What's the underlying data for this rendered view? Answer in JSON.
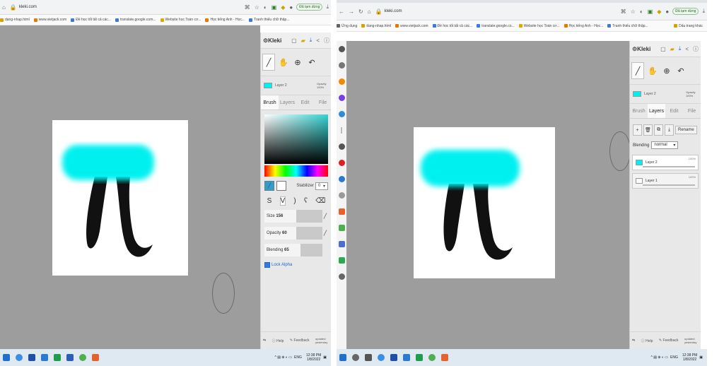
{
  "left": {
    "address": "kleki.com",
    "bookmarks": [
      "dang-nhap.html",
      "www.vietjack.com",
      "Đề học tốt tất cả các...",
      "translate.google.com...",
      "Website học Toán cơ...",
      "Học tiếng Anh - Học...",
      "Tranh thiếu chữ thập..."
    ],
    "profile_label": "Đã tạm dừng",
    "panel": {
      "logo": "Kleki",
      "layer_name": "Layer 2",
      "opacity_label": "Opacity 100%",
      "tabs": [
        "Brush",
        "Layers",
        "Edit",
        "File"
      ],
      "active_tab": "Brush",
      "stabilizer_label": "Stabilizer",
      "stabilizer_value": "0",
      "size_label": "Size",
      "size_value": "156",
      "opacity_slider_label": "Opacity",
      "opacity_slider_value": "60",
      "blending_label": "Blending",
      "blending_value": "65",
      "lock_alpha_label": "Lock Alpha",
      "help_label": "Help",
      "feedback_label": "Feedback",
      "updated_label": "updated yesterday"
    },
    "taskbar": {
      "time": "12:38 PM",
      "date": "1/8/2022",
      "lang": "ENG"
    }
  },
  "right": {
    "address": "kleki.com",
    "apps_label": "Ứng dụng",
    "bookmarks": [
      "dang-nhap.html",
      "www.vietjack.com",
      "Đề học tốt tất cả các...",
      "translate.google.co...",
      "Website học Toán cơ...",
      "Học tiếng Anh - Học...",
      "Tranh thiếu chữ thập..."
    ],
    "profile_label": "Đã tạm dừng",
    "other_bookmarks": "Dấu trang khác",
    "panel": {
      "logo": "Kleki",
      "layer_name": "Layer 2",
      "opacity_label": "Opacity 100%",
      "tabs": [
        "Brush",
        "Layers",
        "Edit",
        "File"
      ],
      "active_tab": "Layers",
      "rename_label": "Rename",
      "blending_label": "Blending",
      "blending_value": "normal",
      "layers": [
        {
          "name": "Layer 2",
          "opacity": "100%"
        },
        {
          "name": "Layer 1",
          "opacity": "100%"
        }
      ],
      "help_label": "Help",
      "feedback_label": "Feedback",
      "updated_label": "updated yesterday"
    },
    "taskbar": {
      "time": "12:38 PM",
      "date": "1/8/2022",
      "lang": "ENG"
    }
  },
  "colors": {
    "brush": "#00f0f0",
    "stroke": "#111111",
    "workspace": "#9d9d9d"
  }
}
